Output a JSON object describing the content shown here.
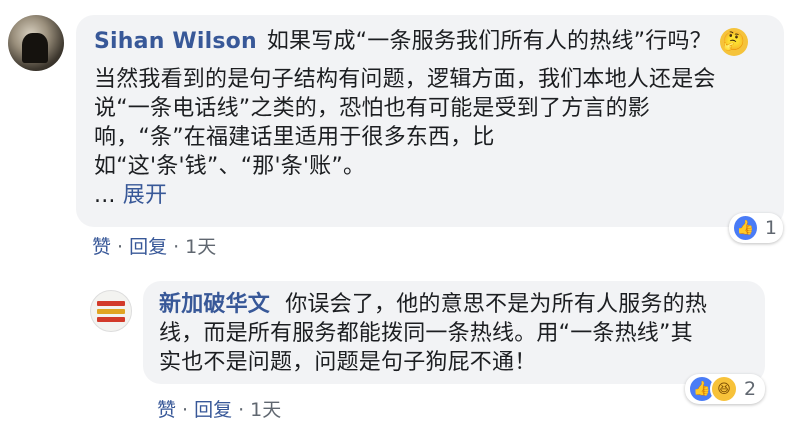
{
  "comments": [
    {
      "author": "Sihan Wilson",
      "first_line_text": "如果写成“一条服务我们所有人的热线”行吗？",
      "body_lines": [
        "当然我看到的是句子结构有问题，逻辑方面，我们本地人还是会",
        "说“一条电话线”之类的，恐怕也有可能是受到了方言的影",
        "响，“条”在福建话里适用于很多东西，比",
        "如“这'条'钱”、“那'条'账”。"
      ],
      "see_more_prefix": "... ",
      "see_more_label": "展开",
      "actions": {
        "like": "赞",
        "reply": "回复",
        "time": "1天",
        "separator": "·"
      },
      "reaction_count": "1",
      "reaction_icons": [
        "like-icon"
      ]
    },
    {
      "author": "新加破华文",
      "first_line_text": "你误会了，他的意思不是为所有人服务的热",
      "body_lines": [
        "线，而是所有服务都能拨同一条热线。用“一条热线”其",
        "实也不是问题，问题是句子狗屁不通！"
      ],
      "actions": {
        "like": "赞",
        "reply": "回复",
        "time": "1天",
        "separator": "·"
      },
      "reaction_count": "2",
      "reaction_icons": [
        "like-icon",
        "haha-icon"
      ]
    }
  ],
  "colors": {
    "author": "#385898",
    "bubble": "#f2f3f5",
    "like": "#4a7cf6",
    "haha": "#f7c23a",
    "meta": "#606770"
  }
}
